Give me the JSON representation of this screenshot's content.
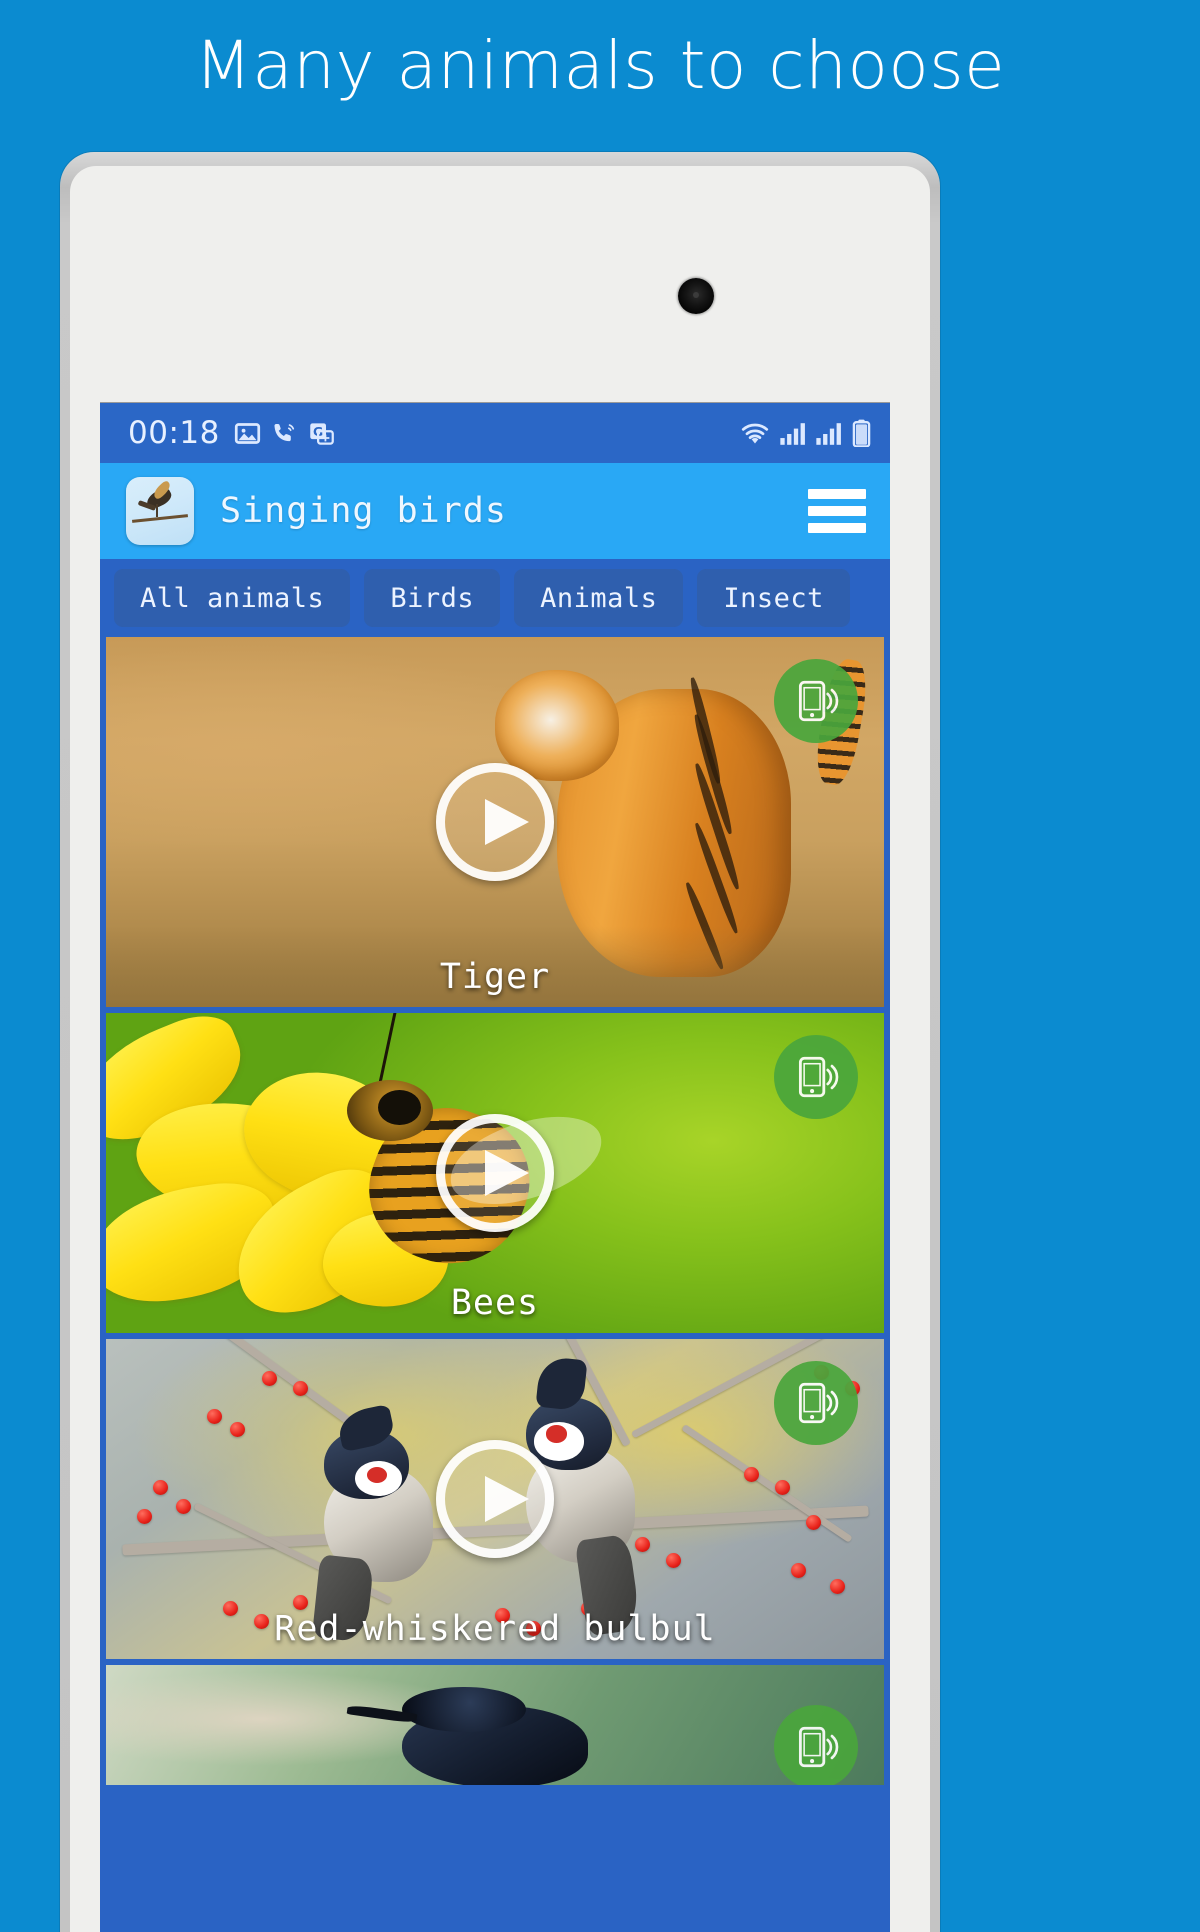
{
  "promo": {
    "headline": "Many animals to choose",
    "background_color": "#0b8bd0"
  },
  "device": {
    "body_color": "#c4c4c4",
    "bezel_color": "#efefed",
    "camera_icon": "front-camera-hole"
  },
  "phone": {
    "status_bar": {
      "time": "00:18",
      "left_icons": [
        "image-icon",
        "phone-call-icon",
        "translate-icon"
      ],
      "right_icons": [
        "wifi-icon",
        "signal-bars-icon",
        "signal-bars-icon",
        "battery-icon"
      ],
      "background_color": "#2b67c6"
    },
    "app_bar": {
      "logo_icon": "bird-on-branch-logo",
      "title": "Singing birds",
      "menu_icon": "hamburger-menu-icon",
      "background_color": "#29a8f5"
    },
    "tabs": {
      "selected": "All animals",
      "items": [
        {
          "label": "All animals"
        },
        {
          "label": "Birds"
        },
        {
          "label": "Animals"
        },
        {
          "label": "Insect"
        }
      ],
      "background_color": "#2a63c4",
      "chip_color": "#2f5fae"
    },
    "list": {
      "play_icon": "play-circle-icon",
      "ringtone_icon": "phone-ringtone-icon",
      "ringtone_badge_color": "#4aa63c",
      "items": [
        {
          "label": "Tiger",
          "image": "tiger-walking-in-dry-grass"
        },
        {
          "label": "Bees",
          "image": "honeybee-on-yellow-flower"
        },
        {
          "label": "Red-whiskered bulbul",
          "image": "two-bulbuls-on-berry-branch"
        },
        {
          "label": "",
          "image": "dark-blue-bird-on-green-background"
        }
      ]
    }
  }
}
